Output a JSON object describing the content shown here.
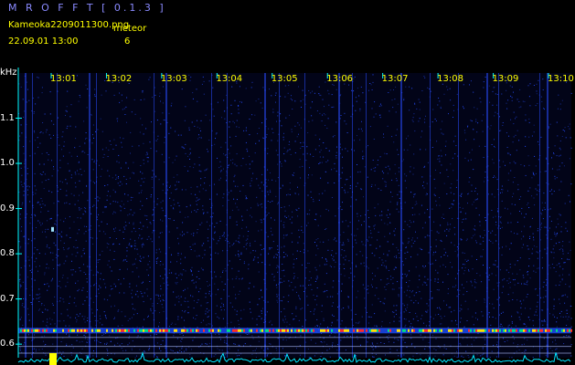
{
  "app": {
    "title": "M R O F F T [ 0.1.3 ]"
  },
  "info": {
    "file_name": "Kameoka2209011300.png",
    "meteor_label": "meteor",
    "datetime": "22.09.01  13:00",
    "meteor_count": "6"
  },
  "spectrogram": {
    "unit": "kHz",
    "time_labels": [
      "13:01",
      "13:02",
      "13:03",
      "13:04",
      "13:05",
      "13:06",
      "13:07",
      "13:08",
      "13:09",
      "13:10"
    ],
    "freq_labels": [
      "1.1",
      "1.0",
      "0.9",
      "0.8",
      "0.7",
      "0.6"
    ],
    "freq_values": [
      1.1,
      1.0,
      0.9,
      0.8,
      0.7,
      0.6
    ],
    "freq_range": [
      0.57,
      1.2
    ],
    "colors": {
      "background": "#000000",
      "noise": "#1a33ff",
      "signal": "#ff2a2a",
      "axis": "#00ffff",
      "labels": "#ffff00"
    }
  }
}
